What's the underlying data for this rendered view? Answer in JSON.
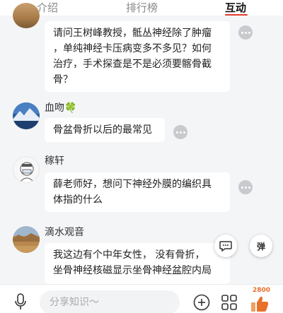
{
  "tabs": [
    {
      "label": "介绍",
      "active": false
    },
    {
      "label": "排行榜",
      "active": false
    },
    {
      "label": "互动",
      "active": true
    }
  ],
  "messages": [
    {
      "username": "",
      "avatar": "landscape-avatar",
      "text_lines": [
        "请问王树峰教授，骶丛神经除了肿瘤",
        "，单纯神经卡压病变多不多见？如何",
        "治疗，手术探查是不是必须要髂骨截",
        "骨？"
      ]
    },
    {
      "username": "血吻🍀",
      "avatar": "mountain-lake-avatar",
      "text_lines": [
        "骨盆骨折以后的最常见"
      ]
    },
    {
      "username": "稼轩",
      "avatar": "cartoon-doctor-avatar",
      "text_lines": [
        "薛老师好，想问下神经外膜的编织具",
        "体指的什么"
      ]
    },
    {
      "username": "滴水观音",
      "avatar": "desert-landscape-avatar",
      "text_lines": [
        "我这边有个中年女性， 没有骨折，",
        "坐骨神经核磁显示坐骨神经盆腔内局"
      ]
    }
  ],
  "floating": {
    "danmu_label": "弹"
  },
  "bottom_bar": {
    "input_placeholder": "分享知识～",
    "like_count": "2800"
  },
  "colors": {
    "accent": "#e23a2e",
    "like": "#e8702a",
    "page_bg": "#f4f5f7"
  }
}
